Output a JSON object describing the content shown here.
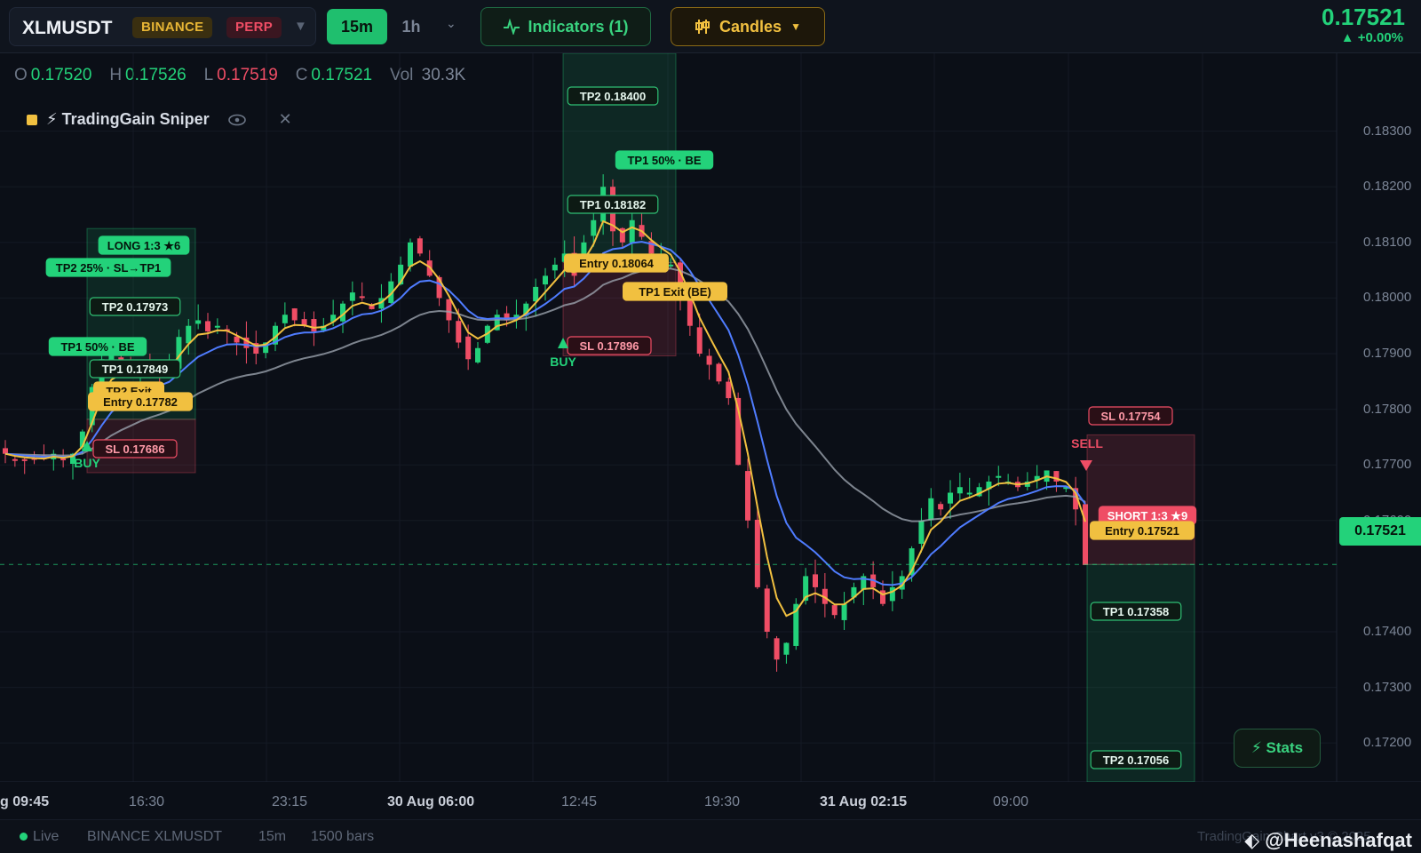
{
  "header": {
    "symbol": "XLMUSDT",
    "exchange_badge": "BINANCE",
    "perp_badge": "PERP",
    "timeframes": [
      "15m",
      "1h"
    ],
    "active_timeframe": "15m",
    "indicators_label": "Indicators (1)",
    "candles_label": "Candles",
    "last_price": "0.17521",
    "change": "+0.00%"
  },
  "ohlc": {
    "o_label": "O",
    "o": "0.17520",
    "h_label": "H",
    "h": "0.17526",
    "l_label": "L",
    "l": "0.17519",
    "c_label": "C",
    "c": "0.17521",
    "vol_label": "Vol",
    "vol": "30.3K"
  },
  "indicator": {
    "name": "⚡ TradingGain Sniper"
  },
  "price_axis": [
    "0.18300",
    "0.18200",
    "0.18100",
    "0.18000",
    "0.17900",
    "0.17800",
    "0.17700",
    "0.17600",
    "0.17400",
    "0.17300",
    "0.17200"
  ],
  "time_axis": [
    {
      "label": "g 09:45",
      "bold": true
    },
    {
      "label": "16:30",
      "bold": false
    },
    {
      "label": "23:15",
      "bold": false
    },
    {
      "label": "30 Aug 06:00",
      "bold": true
    },
    {
      "label": "12:45",
      "bold": false
    },
    {
      "label": "19:30",
      "bold": false
    },
    {
      "label": "31 Aug 02:15",
      "bold": true
    },
    {
      "label": "09:00",
      "bold": false
    }
  ],
  "current_price_tag": "0.17521",
  "trades": [
    {
      "type": "long",
      "header": "LONG 1:3 ★6",
      "trail": "TP2 25% · SL→TP1",
      "tp1_be": "TP1 50% · BE",
      "tp2": "TP2 0.17973",
      "tp1": "TP1 0.17849",
      "exit": "TP2 Exit",
      "entry": "Entry 0.17782",
      "sl": "SL 0.17686",
      "signal": "BUY"
    },
    {
      "type": "long",
      "tp2": "TP2 0.18400",
      "tp1_be": "TP1 50% · BE",
      "tp1": "TP1 0.18182",
      "entry": "Entry 0.18064",
      "exit": "TP1 Exit (BE)",
      "sl": "SL 0.17896",
      "signal": "BUY"
    },
    {
      "type": "short",
      "sl": "SL 0.17754",
      "signal": "SELL",
      "header": "SHORT 1:3 ★9",
      "entry": "Entry 0.17521",
      "tp1": "TP1 0.17358",
      "tp2": "TP2 0.17056"
    }
  ],
  "stats_label": "⚡ Stats",
  "footer": {
    "live": "Live",
    "feed": "BINANCE XLMUSDT",
    "tf": "15m",
    "bars": "1500 bars",
    "credit": "TradingGain Chart v3 © 2025",
    "watermark": "@Heenashafqat"
  },
  "colors": {
    "bg": "#0b0f17",
    "up": "#23d27a",
    "down": "#ef4d65",
    "ema_fast": "#f1c040",
    "ema_mid": "#4f7cff",
    "ema_slow": "#9aa1ad"
  },
  "chart_data": {
    "type": "candlestick",
    "ylim": [
      0.1713,
      0.1844
    ],
    "close": [
      0.1772,
      0.1771,
      0.1771,
      0.1771,
      0.1771,
      0.1772,
      0.1771,
      0.1772,
      0.1776,
      0.1784,
      0.1789,
      0.179,
      0.1788,
      0.1787,
      0.1788,
      0.1787,
      0.1786,
      0.1788,
      0.1793,
      0.1795,
      0.1796,
      0.1794,
      0.1795,
      0.1794,
      0.1792,
      0.1791,
      0.179,
      0.1792,
      0.1795,
      0.1797,
      0.1796,
      0.1795,
      0.1794,
      0.1795,
      0.1797,
      0.1799,
      0.1801,
      0.18,
      0.1798,
      0.18,
      0.1803,
      0.1806,
      0.181,
      0.1808,
      0.1804,
      0.18,
      0.1796,
      0.1792,
      0.1789,
      0.1791,
      0.1795,
      0.1797,
      0.1796,
      0.1797,
      0.1799,
      0.1802,
      0.1804,
      0.1806,
      0.1808,
      0.1804,
      0.181,
      0.1814,
      0.182,
      0.1812,
      0.181,
      0.1814,
      0.1811,
      0.1808,
      0.1807,
      0.1806,
      0.18,
      0.1795,
      0.179,
      0.1788,
      0.1785,
      0.1782,
      0.177,
      0.176,
      0.1748,
      0.174,
      0.1735,
      0.1738,
      0.1745,
      0.175,
      0.1748,
      0.1745,
      0.1743,
      0.1745,
      0.1748,
      0.175,
      0.1748,
      0.1745,
      0.1748,
      0.175,
      0.1755,
      0.176,
      0.1764,
      0.1762,
      0.1765,
      0.1766,
      0.1765,
      0.1766,
      0.1767,
      0.1768,
      0.1767,
      0.1766,
      0.1767,
      0.1768,
      0.1769,
      0.1767,
      0.1766,
      0.1762,
      0.1752
    ]
  }
}
